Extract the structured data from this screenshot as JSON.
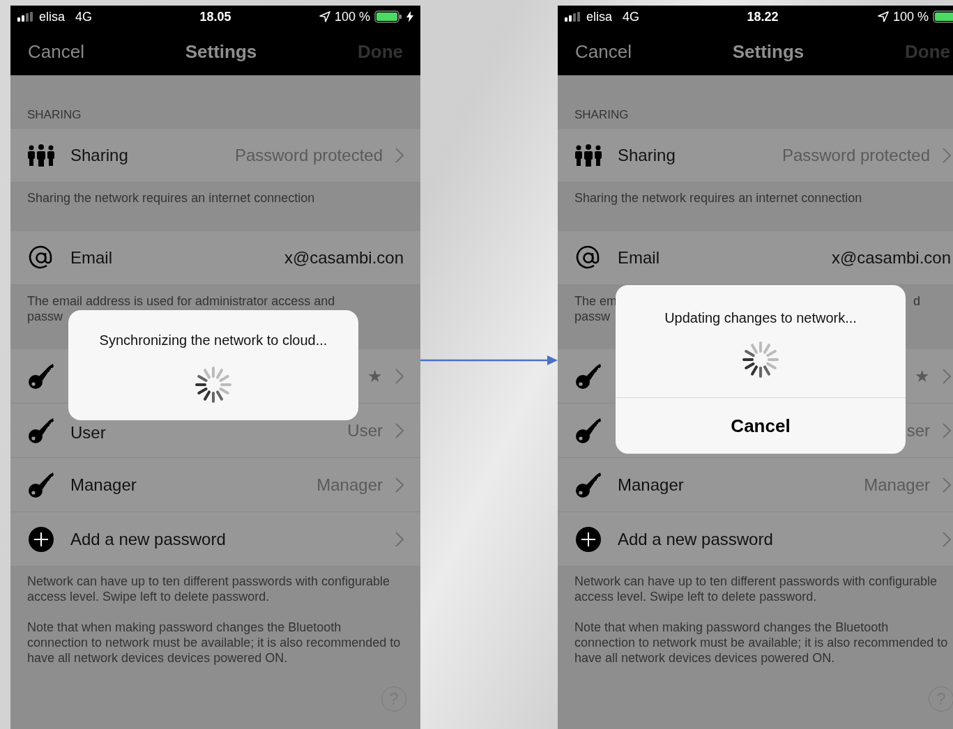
{
  "phones": [
    {
      "status": {
        "carrier": "elisa",
        "network": "4G",
        "time": "18.05",
        "battery": "100 %",
        "charging": true
      },
      "nav": {
        "cancel": "Cancel",
        "title": "Settings",
        "done": "Done",
        "done_disabled": true
      },
      "section_header": "SHARING",
      "sharing_row": {
        "title": "Sharing",
        "value": "Password protected"
      },
      "sharing_note": "Sharing the network requires an internet connection",
      "email_row": {
        "title": "Email",
        "value": "x@casambi.con"
      },
      "email_note_lines": [
        [
          "The email address is used for administrator access and"
        ],
        [
          "passw"
        ]
      ],
      "password_rows": [
        {
          "kind": "key",
          "value": "★"
        },
        {
          "kind": "key",
          "title": "User",
          "value": "User"
        },
        {
          "kind": "key",
          "title": "Manager",
          "value": "Manager"
        },
        {
          "kind": "add",
          "title": "Add a new password"
        }
      ],
      "password_notes": [
        "Network can have up to ten different passwords with configurable access level. Swipe left to delete password.",
        "Note that when making password changes the Bluetooth connection to network must be available; it is also recommended to have all network devices devices powered ON."
      ],
      "help": "?",
      "dialog": {
        "message": "Synchronizing the network to cloud..."
      }
    },
    {
      "status": {
        "carrier": "elisa",
        "network": "4G",
        "time": "18.22",
        "battery": "100 %"
      },
      "nav": {
        "cancel": "Cancel",
        "title": "Settings",
        "done": "Done",
        "done_disabled": true
      },
      "section_header": "SHARING",
      "sharing_row": {
        "title": "Sharing",
        "value": "Password protected"
      },
      "sharing_note": "Sharing the network requires an internet connection",
      "email_row": {
        "title": "Email",
        "value": "x@casambi.con"
      },
      "email_note_lines": [
        [
          "The em",
          "d"
        ],
        [
          "passw"
        ]
      ],
      "password_rows": [
        {
          "kind": "key",
          "value": "★"
        },
        {
          "kind": "key",
          "value": "ser"
        },
        {
          "kind": "key",
          "title": "Manager",
          "value": "Manager"
        },
        {
          "kind": "add",
          "title": "Add a new password"
        }
      ],
      "password_notes": [
        "Network can have up to ten different passwords with configurable access level. Swipe left to delete password.",
        "Note that when making password changes the Bluetooth connection to network must be available; it is also recommended to have all network devices devices powered ON."
      ],
      "help": "?",
      "dialog": {
        "message": "Updating changes to network...",
        "cancel_button": "Cancel"
      }
    }
  ]
}
